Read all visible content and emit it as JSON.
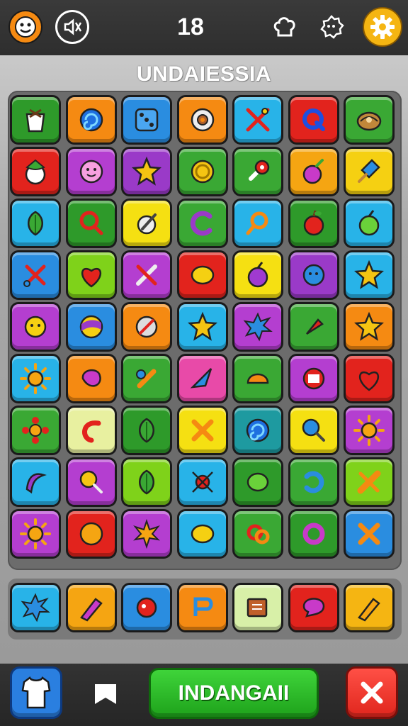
{
  "header": {
    "score": "18",
    "icons": [
      "face-icon",
      "mute-icon",
      "chef-hat-icon",
      "badge-icon",
      "settings-gear-icon"
    ]
  },
  "board": {
    "title": "UNDAIESSIA",
    "rows": [
      [
        [
          "#2e9a2a",
          "cup-icon"
        ],
        [
          "#f58a12",
          "swirl-icon"
        ],
        [
          "#2a8de0",
          "dice-icon"
        ],
        [
          "#f58a12",
          "donut-icon"
        ],
        [
          "#28b3e8",
          "tools-icon"
        ],
        [
          "#e2231d",
          "letter-q-icon"
        ],
        [
          "#3aa834",
          "shell-icon"
        ]
      ],
      [
        [
          "#e2231d",
          "coconut-icon"
        ],
        [
          "#b43ed0",
          "flower-face-icon"
        ],
        [
          "#9a3ac8",
          "star-icon"
        ],
        [
          "#3aa834",
          "coin-icon"
        ],
        [
          "#3aa834",
          "pin-icon"
        ],
        [
          "#f5a512",
          "radish-icon"
        ],
        [
          "#f5d012",
          "popsicle-icon"
        ]
      ],
      [
        [
          "#28b3e8",
          "leaf-icon"
        ],
        [
          "#2e9a2a",
          "magnifier-icon"
        ],
        [
          "#f5e012",
          "wrench-icon"
        ],
        [
          "#3aa834",
          "crescent-icon"
        ],
        [
          "#28b3e8",
          "search-icon"
        ],
        [
          "#2e9a2a",
          "apple-icon"
        ],
        [
          "#28b3e8",
          "green-apple-icon"
        ]
      ],
      [
        [
          "#2a8de0",
          "scissors-icon"
        ],
        [
          "#7fd21a",
          "heart-icon"
        ],
        [
          "#b43ed0",
          "knife-icon"
        ],
        [
          "#e2231d",
          "lemon-icon"
        ],
        [
          "#f5e012",
          "plum-icon"
        ],
        [
          "#9a3ac8",
          "bubble-icon"
        ],
        [
          "#28b3e8",
          "star-icon"
        ]
      ],
      [
        [
          "#b43ed0",
          "face-icon"
        ],
        [
          "#2a8de0",
          "ball-icon"
        ],
        [
          "#f58a12",
          "shield-icon"
        ],
        [
          "#28b3e8",
          "star-icon"
        ],
        [
          "#b43ed0",
          "splat-icon"
        ],
        [
          "#3aa834",
          "carrot-icon"
        ],
        [
          "#f58a12",
          "star-icon"
        ]
      ],
      [
        [
          "#28b3e8",
          "sun-icon"
        ],
        [
          "#f58a12",
          "blob-icon"
        ],
        [
          "#3aa834",
          "bone-icon"
        ],
        [
          "#e84aa8",
          "arrow-icon"
        ],
        [
          "#3aa834",
          "bread-icon"
        ],
        [
          "#b43ed0",
          "radio-icon"
        ],
        [
          "#e2231d",
          "heart-icon"
        ]
      ],
      [
        [
          "#3aa834",
          "flower-icon"
        ],
        [
          "#e8f0a0",
          "chili-icon"
        ],
        [
          "#2e9a2a",
          "leaf-icon"
        ],
        [
          "#f5e012",
          "cross-icon"
        ],
        [
          "#1e9aa0",
          "swirl-icon"
        ],
        [
          "#f5e012",
          "racket-icon"
        ],
        [
          "#b43ed0",
          "sun-icon"
        ]
      ],
      [
        [
          "#28b3e8",
          "boomerang-icon"
        ],
        [
          "#b43ed0",
          "lollipop-icon"
        ],
        [
          "#7fd21a",
          "leaf-icon"
        ],
        [
          "#28b3e8",
          "bug-icon"
        ],
        [
          "#2e9a2a",
          "lime-icon"
        ],
        [
          "#3aa834",
          "horseshoe-icon"
        ],
        [
          "#7fd21a",
          "bandage-icon"
        ]
      ],
      [
        [
          "#b43ed0",
          "sun-icon"
        ],
        [
          "#e2231d",
          "orange-icon"
        ],
        [
          "#b43ed0",
          "maple-icon"
        ],
        [
          "#28b3e8",
          "lemon-icon"
        ],
        [
          "#3aa834",
          "pretzel-icon"
        ],
        [
          "#2e9a2a",
          "ring-icon"
        ],
        [
          "#2a8de0",
          "cross-icon"
        ]
      ]
    ]
  },
  "tray": [
    [
      "#28b3e8",
      "splat-icon"
    ],
    [
      "#f5a512",
      "crayon-icon"
    ],
    [
      "#2a8de0",
      "ladybug-icon"
    ],
    [
      "#f58a12",
      "letter-r-icon"
    ],
    [
      "#d8f0a8",
      "book-icon"
    ],
    [
      "#e2231d",
      "speech-icon"
    ],
    [
      "#f5b512",
      "pencil-icon"
    ]
  ],
  "footer": {
    "main_button": "INDANGAII",
    "icons": [
      "shirt-icon",
      "flag-icon",
      "close-icon"
    ]
  }
}
